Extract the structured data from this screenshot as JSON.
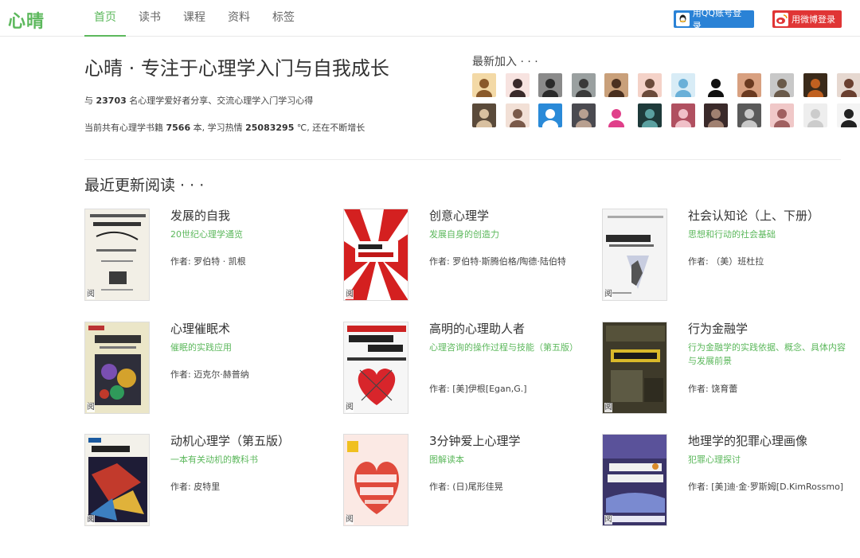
{
  "header": {
    "logo": "心晴",
    "nav": [
      "首页",
      "读书",
      "课程",
      "资料",
      "标签"
    ],
    "qq_login": "用QQ账号登录",
    "weibo_login": "用微博登录"
  },
  "hero": {
    "title": "心晴 · 专注于心理学入门与自我成长",
    "line1_pre": "与 ",
    "line1_count": "23703",
    "line1_post": " 名心理学爱好者分享、交流心理学入门学习心得",
    "line2_pre": "当前共有心理学书籍 ",
    "line2_books": "7566",
    "line2_mid": " 本, 学习热情 ",
    "line2_heat": "25083295",
    "line2_post": " ℃, 还在不断增长"
  },
  "newest": {
    "title": "最新加入 · · ·"
  },
  "recent": {
    "title": "最近更新阅读 · · ·",
    "cover_mark": "阅",
    "books": [
      {
        "title": "发展的自我",
        "subtitle": "20世纪心理学通览",
        "author": "作者: 罗伯特 · 凯根"
      },
      {
        "title": "创意心理学",
        "subtitle": "发展自身的创造力",
        "author": "作者: 罗伯特·斯腾伯格/陶德·陆伯特"
      },
      {
        "title": "社会认知论（上、下册）",
        "subtitle": "思想和行动的社会基础",
        "author": "作者: （美）班杜拉"
      },
      {
        "title": "心理催眠术",
        "subtitle": "催眠的实践应用",
        "author": "作者: 迈克尔·赫普纳"
      },
      {
        "title": "高明的心理助人者",
        "subtitle": "心理咨询的操作过程与技能（第五版）",
        "author": "作者: [美]伊根[Egan,G.]"
      },
      {
        "title": "行为金融学",
        "subtitle": "行为金融学的实践依据、概念、具体内容与发展前景",
        "author": "作者: 饶育蕾"
      },
      {
        "title": "动机心理学（第五版）",
        "subtitle": "一本有关动机的教科书",
        "author": "作者: 皮特里"
      },
      {
        "title": "3分钟爱上心理学",
        "subtitle": "图解读本",
        "author": "作者: (日)尾形佳晃"
      },
      {
        "title": "地理学的犯罪心理画像",
        "subtitle": "犯罪心理探讨",
        "author": "作者: [美]迪·金·罗斯姆[D.KimRossmo]"
      }
    ]
  },
  "colors": {
    "accent": "#5cb85c",
    "qq": "#2a82d6",
    "weibo": "#e03535"
  }
}
